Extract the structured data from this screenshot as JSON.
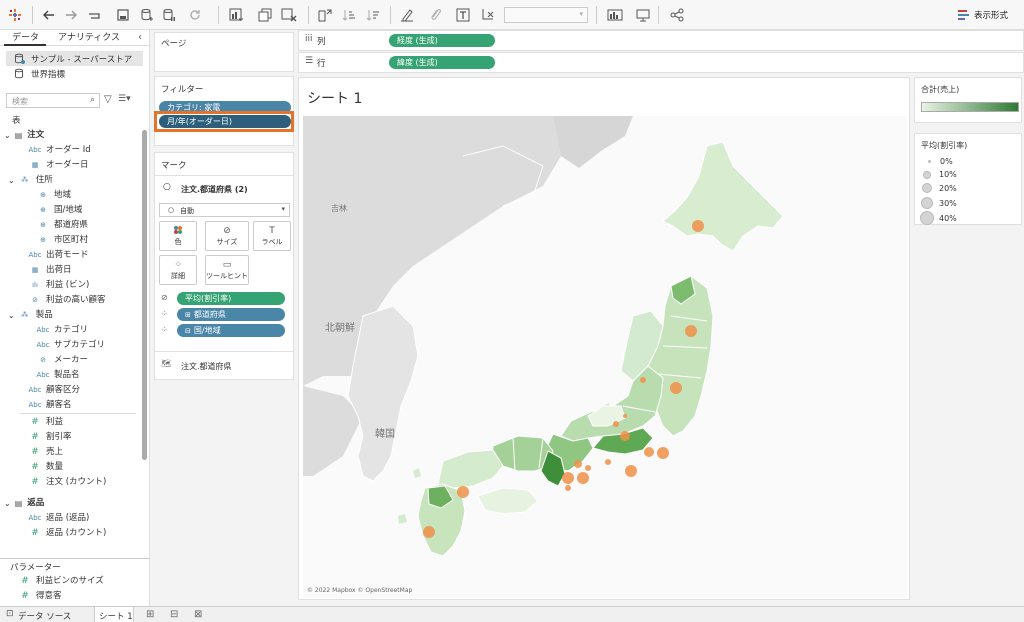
{
  "toolbar": {
    "format_label": "表示形式",
    "icons": [
      "tableau-logo-icon",
      "undo-icon",
      "redo-icon",
      "replay-icon",
      "save-icon",
      "new-datasource-icon",
      "pause-icon",
      "refresh-icon",
      "new-sheet-icon",
      "duplicate-icon",
      "clear-icon",
      "swap-icon",
      "sort-asc-icon",
      "sort-desc-icon",
      "highlight-icon",
      "group-icon",
      "label-icon",
      "fix-axes-icon",
      "fit-icon",
      "show-cards-icon",
      "presentation-icon",
      "share-icon"
    ]
  },
  "left_panel": {
    "tabs": [
      "データ",
      "アナリティクス"
    ],
    "datasources": [
      "サンプル - スーパーストア",
      "世界指標"
    ],
    "search_placeholder": "検索",
    "section_table": "表",
    "groups": [
      {
        "name": "注文",
        "fields": [
          {
            "type": "Abc",
            "label": "オーダー Id"
          },
          {
            "type": "date",
            "label": "オーダー日"
          },
          {
            "type": "hier",
            "label": "住所"
          },
          {
            "type": "geo",
            "label": "地域"
          },
          {
            "type": "geo",
            "label": "国/地域"
          },
          {
            "type": "geo",
            "label": "都道府県"
          },
          {
            "type": "geo",
            "label": "市区町村"
          },
          {
            "type": "Abc",
            "label": "出荷モード"
          },
          {
            "type": "date",
            "label": "出荷日"
          },
          {
            "type": "bin",
            "label": "利益 (ビン)"
          },
          {
            "type": "set",
            "label": "利益の高い顧客"
          },
          {
            "type": "hier",
            "label": "製品"
          },
          {
            "type": "Abc",
            "label": "カテゴリ"
          },
          {
            "type": "Abc",
            "label": "サブカテゴリ"
          },
          {
            "type": "clip",
            "label": "メーカー"
          },
          {
            "type": "Abc",
            "label": "製品名"
          },
          {
            "type": "Abc",
            "label": "顧客区分"
          },
          {
            "type": "Abc",
            "label": "顧客名"
          },
          {
            "type": "#",
            "label": "利益"
          },
          {
            "type": "#",
            "label": "割引率"
          },
          {
            "type": "#",
            "label": "売上"
          },
          {
            "type": "#",
            "label": "数量"
          },
          {
            "type": "#",
            "label": "注文 (カウント)"
          }
        ]
      },
      {
        "name": "返品",
        "fields": [
          {
            "type": "Abc",
            "label": "返品 (返品)"
          },
          {
            "type": "#",
            "label": "返品 (カウント)"
          }
        ]
      }
    ],
    "parameters_title": "パラメーター",
    "parameters": [
      "利益ビンのサイズ",
      "得意客"
    ]
  },
  "pages_label": "ページ",
  "columns_label": "列",
  "rows_label": "行",
  "columns_pill": "経度 (生成)",
  "rows_pill": "緯度 (生成)",
  "filters": {
    "title": "フィルター",
    "items": [
      "カテゴリ: 家電",
      "月/年(オーダー日)"
    ]
  },
  "marks": {
    "title": "マーク",
    "layer": "注文.都道府県 (2)",
    "mark_type": "自動",
    "buttons": [
      "色",
      "サイズ",
      "ラベル",
      "詳細",
      "ツールヒント"
    ],
    "pills": [
      "平均(割引率)",
      "都道府県",
      "国/地域"
    ],
    "layer2": "注文.都道府県"
  },
  "sheet": {
    "title": "シート 1",
    "map_labels": [
      "吉林",
      "北朝鮮",
      "韓国"
    ],
    "attribution": "© 2022 Mapbox © OpenStreetMap"
  },
  "legend_color": {
    "title": "合計(売上)",
    "low": "#e8f3e4",
    "high": "#2f7a35"
  },
  "legend_size": {
    "title": "平均(割引率)",
    "items": [
      "0%",
      "10%",
      "20%",
      "30%",
      "40%"
    ]
  },
  "bottom_tabs": [
    "データ ソース",
    "シート 1"
  ],
  "colors": {
    "accent_green": "#35a373",
    "dim_blue": "#4a86a8",
    "highlight_orange": "#e5732a",
    "circle_orange": "#f0914a"
  }
}
